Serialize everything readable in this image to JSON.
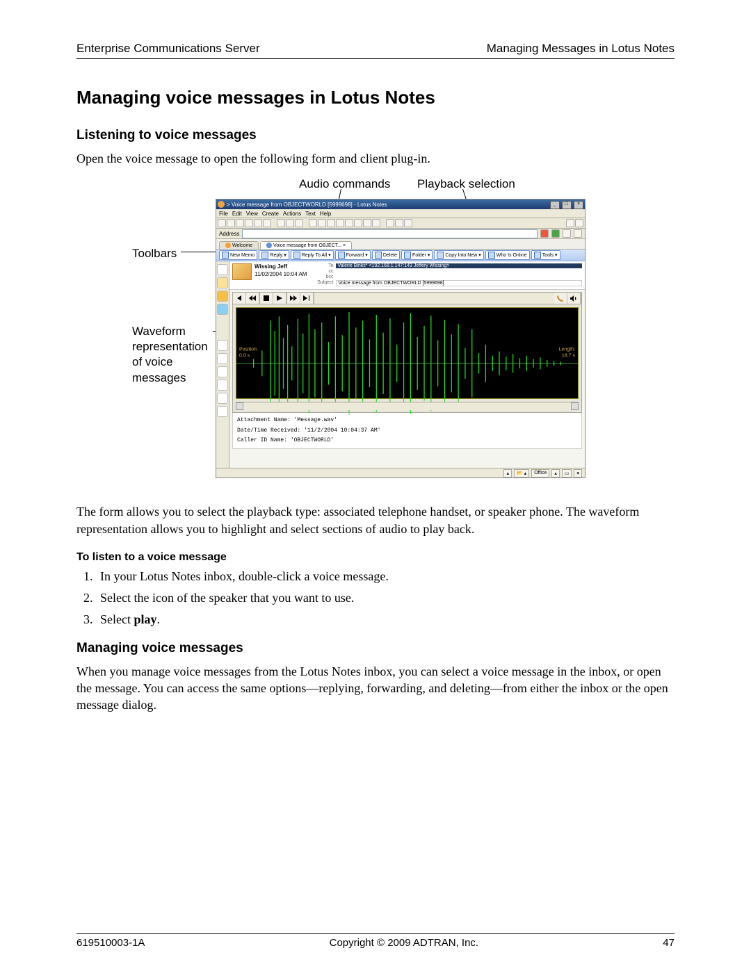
{
  "header": {
    "left": "Enterprise Communications Server",
    "right": "Managing Messages in Lotus Notes"
  },
  "h1": "Managing voice messages in Lotus Notes",
  "sec1": {
    "title": "Listening to voice messages",
    "intro": "Open the voice message to open the following form and client plug-in."
  },
  "callouts": {
    "audio": "Audio commands",
    "playback": "Playback selection",
    "toolbars": "Toolbars",
    "waveform": "Waveform\nrepresentation\nof voice\nmessages"
  },
  "screenshot": {
    "title": "> Voice message from OBJECTWORLD [5999698] - Lotus Notes",
    "menu": [
      "File",
      "Edit",
      "View",
      "Create",
      "Actions",
      "Text",
      "Help"
    ],
    "address_label": "Address",
    "tabs": {
      "welcome": "Welcome",
      "msg": "Voice message from OBJECT...  ×"
    },
    "actions": [
      "New Memo",
      "Reply ▾",
      "Reply To All ▾",
      "Forward ▾",
      "Delete",
      "Folder ▾",
      "Copy Into New ▾",
      "Who Is Online",
      "Tools ▾"
    ],
    "message": {
      "from": "Wissing Jeff",
      "date": "11/02/2004 10:04 AM",
      "to_label": "To",
      "to": "Valerie Binks* <192.168.1.147:143 Jeffery Wissing>",
      "cc_label": "cc",
      "cc": "",
      "bcc_label": "bcc",
      "bcc": "",
      "subj_label": "Subject",
      "subject": "Voice message from OBJECTWORLD [5999698]"
    },
    "player": {
      "position_label": "Position:",
      "position": "0.0 s",
      "length_label": "Length:",
      "length": "18.7 s"
    },
    "attachment": {
      "l1": "Attachment Name: 'Message.wav'",
      "l2": "Date/Time Received: '11/2/2004 10:04:37 AM'",
      "l3": "Caller ID Name: 'OBJECTWORLD'"
    },
    "status_office": "Office"
  },
  "after_fig": "The form allows you to select the playback type: associated telephone handset, or speaker phone. The waveform representation allows you to highlight and select sections of audio to play back.",
  "howto_title": "To listen to a voice message",
  "steps": [
    "In your Lotus Notes inbox, double-click a voice message.",
    "Select the icon of the speaker that you want to use.",
    "Select "
  ],
  "step3_bold": "play",
  "step3_tail": ".",
  "sec2": {
    "title": "Managing voice messages",
    "para": "When you manage voice messages from the Lotus Notes inbox, you can select a voice message in the inbox, or open the message. You can access the same options—replying, forwarding, and deleting—from either the inbox or the open message dialog."
  },
  "footer": {
    "left": "619510003-1A",
    "center": "Copyright © 2009 ADTRAN, Inc.",
    "right": "47"
  }
}
